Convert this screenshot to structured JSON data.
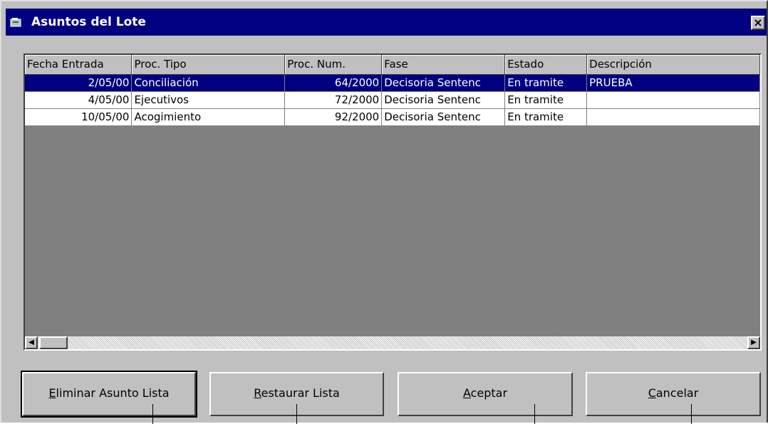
{
  "window": {
    "title": "Asuntos del Lote",
    "close_glyph": "×"
  },
  "grid": {
    "columns": [
      "Fecha Entrada",
      "Proc. Tipo",
      "Proc. Num.",
      "Fase",
      "Estado",
      "Descripción"
    ],
    "rows": [
      {
        "fecha": "2/05/00",
        "tipo": "Conciliación",
        "num": "64/2000",
        "fase": "Decisoria Sentenc",
        "estado": "En tramite",
        "descripcion": "PRUEBA",
        "selected": true
      },
      {
        "fecha": "4/05/00",
        "tipo": "Ejecutivos",
        "num": "72/2000",
        "fase": "Decisoria Sentenc",
        "estado": "En tramite",
        "descripcion": ""
      },
      {
        "fecha": "10/05/00",
        "tipo": "Acogimiento",
        "num": "92/2000",
        "fase": "Decisoria Sentenc",
        "estado": "En tramite",
        "descripcion": ""
      }
    ],
    "scroll_left_glyph": "◀",
    "scroll_right_glyph": "▶"
  },
  "buttons": {
    "eliminar": {
      "accel": "E",
      "rest": "liminar Asunto Lista"
    },
    "restaurar": {
      "accel": "R",
      "rest": "estaurar Lista"
    },
    "aceptar": {
      "accel": "A",
      "rest": "ceptar"
    },
    "cancelar": {
      "accel": "C",
      "rest": "ancelar"
    }
  },
  "colors": {
    "title_bar": "#000080",
    "selection": "#000080",
    "face": "#c0c0c0",
    "grid_empty": "#808080"
  },
  "icons": [
    "window-app-icon",
    "close-icon",
    "scroll-left-icon",
    "scroll-right-icon"
  ]
}
